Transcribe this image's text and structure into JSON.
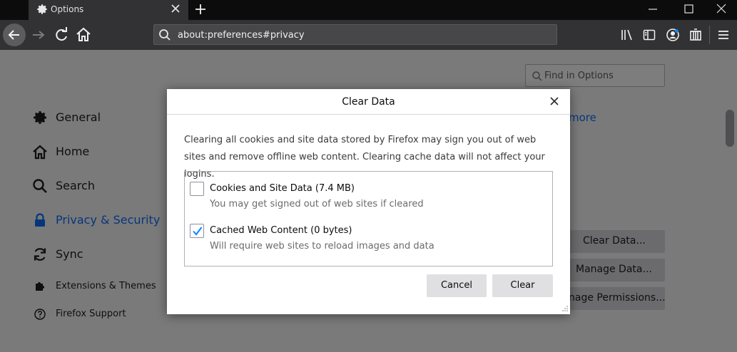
{
  "browser": {
    "tab_title": "Options",
    "url": "about:preferences#privacy"
  },
  "sidebar": {
    "items": [
      {
        "label": "General",
        "icon": "gear-icon"
      },
      {
        "label": "Home",
        "icon": "home-icon"
      },
      {
        "label": "Search",
        "icon": "search-icon"
      },
      {
        "label": "Privacy & Security",
        "icon": "lock-icon"
      },
      {
        "label": "Sync",
        "icon": "sync-icon"
      },
      {
        "label": "Extensions & Themes",
        "icon": "puzzle-icon"
      },
      {
        "label": "Firefox Support",
        "icon": "help-icon"
      }
    ]
  },
  "content": {
    "find_placeholder": "Find in Options",
    "learn_more_fragment": "more",
    "clear_data_button": "Clear Data...",
    "manage_data_button": "Manage Data...",
    "manage_permissions_button": "nage Permissions..."
  },
  "dialog": {
    "title": "Clear Data",
    "description": "Clearing all cookies and site data stored by Firefox may sign you out of web sites and remove offline web content. Clearing cache data will not affect your logins.",
    "options": [
      {
        "label": "Cookies and Site Data (7.4 MB)",
        "sublabel": "You may get signed out of web sites if cleared",
        "checked": false
      },
      {
        "label": "Cached Web Content (0 bytes)",
        "sublabel": "Will require web sites to reload images and data",
        "checked": true
      }
    ],
    "cancel_label": "Cancel",
    "clear_label": "Clear"
  },
  "colors": {
    "accent": "#0a84ff",
    "chrome_dark": "#0c0c0d",
    "toolbar": "#323234",
    "overlay": "#7a7a7b"
  }
}
